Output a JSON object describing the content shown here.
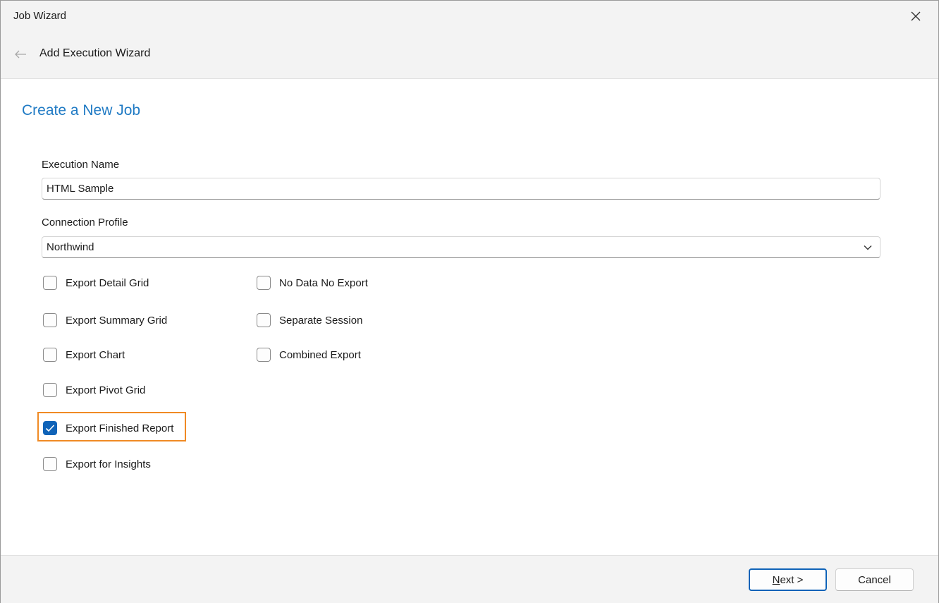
{
  "window": {
    "title": "Job Wizard"
  },
  "header": {
    "subtitle": "Add Execution Wizard"
  },
  "main": {
    "heading": "Create a New Job",
    "execution_name": {
      "label": "Execution Name",
      "value": "HTML Sample"
    },
    "connection_profile": {
      "label": "Connection Profile",
      "value": "Northwind"
    },
    "checkboxes": [
      {
        "label": "Export Detail Grid",
        "checked": false
      },
      {
        "label": "Export Summary Grid",
        "checked": false
      },
      {
        "label": "Export Chart",
        "checked": false
      },
      {
        "label": "Export Pivot Grid",
        "checked": false
      },
      {
        "label": "Export Finished Report",
        "checked": true
      },
      {
        "label": "Export for Insights",
        "checked": false
      },
      {
        "label": "No Data No Export",
        "checked": false
      },
      {
        "label": "Separate Session",
        "checked": false
      },
      {
        "label": "Combined Export",
        "checked": false
      }
    ]
  },
  "footer": {
    "next_mnemonic": "N",
    "next_rest": "ext >",
    "cancel_label": "Cancel"
  },
  "colors": {
    "accent": "#0f63b8",
    "heading": "#1f7ac4",
    "highlight": "#f08a24"
  },
  "icons": {
    "close": "close-icon",
    "back": "back-arrow-icon",
    "dropdown": "chevron-down-icon",
    "check": "checkmark-icon"
  }
}
